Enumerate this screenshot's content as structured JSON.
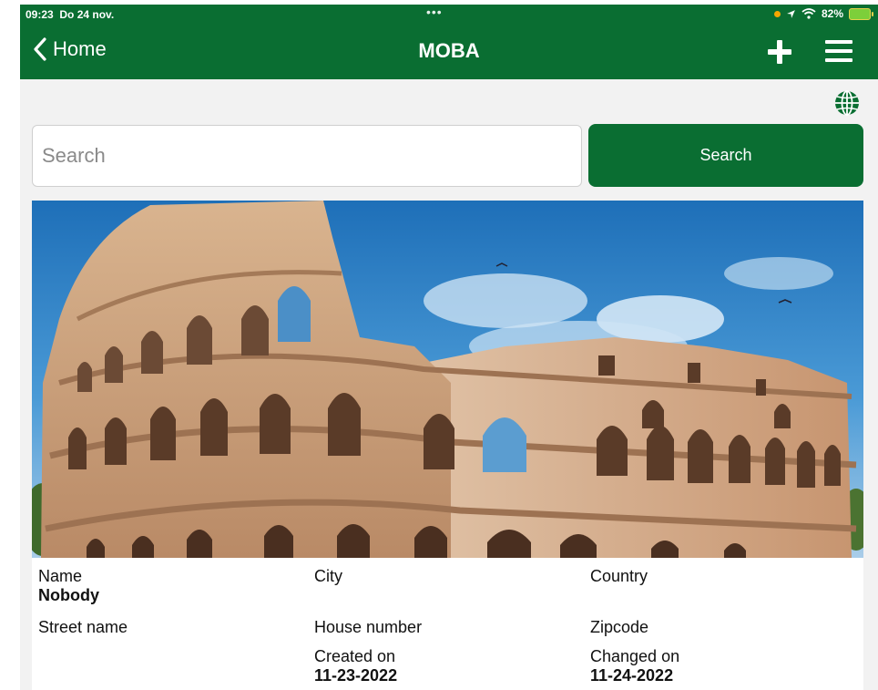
{
  "status": {
    "time": "09:23",
    "date": "Do 24 nov.",
    "battery": "82%"
  },
  "nav": {
    "back_label": "Home",
    "title": "MOBA"
  },
  "search": {
    "placeholder": "Search",
    "button_label": "Search"
  },
  "colors": {
    "brand": "#0a6e32",
    "status_orange": "#f7a600"
  },
  "details": {
    "name_label": "Name",
    "name_value": "Nobody",
    "city_label": "City",
    "country_label": "Country",
    "street_label": "Street name",
    "house_label": "House number",
    "zipcode_label": "Zipcode",
    "created_label": "Created on",
    "created_value": "11-23-2022",
    "changed_label": "Changed on",
    "changed_value": "11-24-2022"
  }
}
